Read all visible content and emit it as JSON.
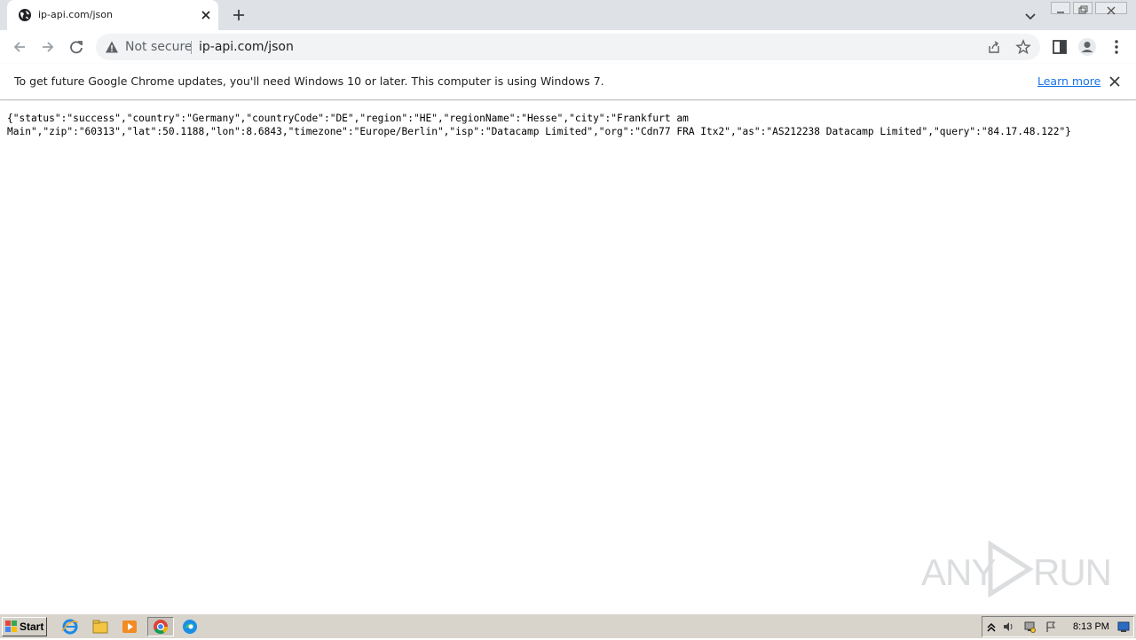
{
  "browser": {
    "tab_title": "ip-api.com/json",
    "new_tab_label": "+"
  },
  "omnibox": {
    "security_label": "Not secure",
    "url": "ip-api.com/json"
  },
  "infobar": {
    "message": "To get future Google Chrome updates, you'll need Windows 10 or later. This computer is using Windows 7.",
    "link_label": "Learn more"
  },
  "page": {
    "json_text": "{\"status\":\"success\",\"country\":\"Germany\",\"countryCode\":\"DE\",\"region\":\"HE\",\"regionName\":\"Hesse\",\"city\":\"Frankfurt am\nMain\",\"zip\":\"60313\",\"lat\":50.1188,\"lon\":8.6843,\"timezone\":\"Europe/Berlin\",\"isp\":\"Datacamp Limited\",\"org\":\"Cdn77 FRA Itx2\",\"as\":\"AS212238 Datacamp Limited\",\"query\":\"84.17.48.122\"}"
  },
  "watermark": {
    "left": "ANY",
    "right": "RUN"
  },
  "taskbar": {
    "start_label": "Start",
    "clock": "8:13 PM"
  },
  "colors": {
    "tabstrip": "#dee1e6",
    "link": "#1a73e8",
    "taskbar": "#d8d4cc"
  },
  "icons": [
    "globe-icon",
    "close-icon",
    "plus-icon",
    "chevron-down-icon",
    "back-arrow-icon",
    "forward-arrow-icon",
    "reload-icon",
    "warning-icon",
    "share-icon",
    "star-icon",
    "side-panel-icon",
    "profile-icon",
    "kebab-menu-icon",
    "windows-logo-icon",
    "ie-icon",
    "explorer-icon",
    "media-player-icon",
    "chrome-icon",
    "edge-icon",
    "show-hidden-icons",
    "volume-icon",
    "network-icon",
    "flag-icon",
    "show-desktop-icon"
  ]
}
